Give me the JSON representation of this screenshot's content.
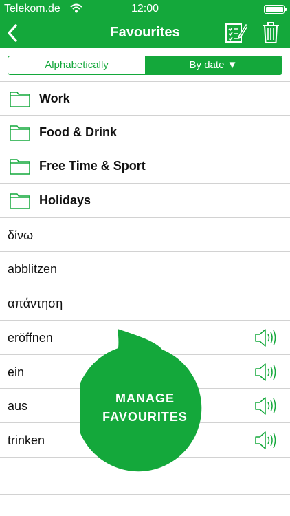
{
  "status_bar": {
    "carrier": "Telekom.de",
    "time": "12:00"
  },
  "nav": {
    "title": "Favourites"
  },
  "sort": {
    "alphabetical": "Alphabetically",
    "by_date": "By date ▼"
  },
  "folders": [
    {
      "label": "Work"
    },
    {
      "label": "Food & Drink"
    },
    {
      "label": "Free Time & Sport"
    },
    {
      "label": "Holidays"
    }
  ],
  "words": [
    {
      "label": "δίνω",
      "audio": false
    },
    {
      "label": "abblitzen",
      "audio": false
    },
    {
      "label": "απάντηση",
      "audio": false
    },
    {
      "label": "eröffnen",
      "audio": true
    },
    {
      "label": "ein",
      "audio": true
    },
    {
      "label": "aus",
      "audio": true
    },
    {
      "label": "trinken",
      "audio": true
    }
  ],
  "promo": {
    "line1": "MANAGE",
    "line2": "FAVOURITES"
  },
  "colors": {
    "brand_green": "#14a83b",
    "divider": "#d2d2d2"
  },
  "icons": [
    "back-chevron-icon",
    "edit-list-icon",
    "trash-icon",
    "folder-icon",
    "speaker-icon",
    "wifi-icon",
    "battery-icon"
  ]
}
